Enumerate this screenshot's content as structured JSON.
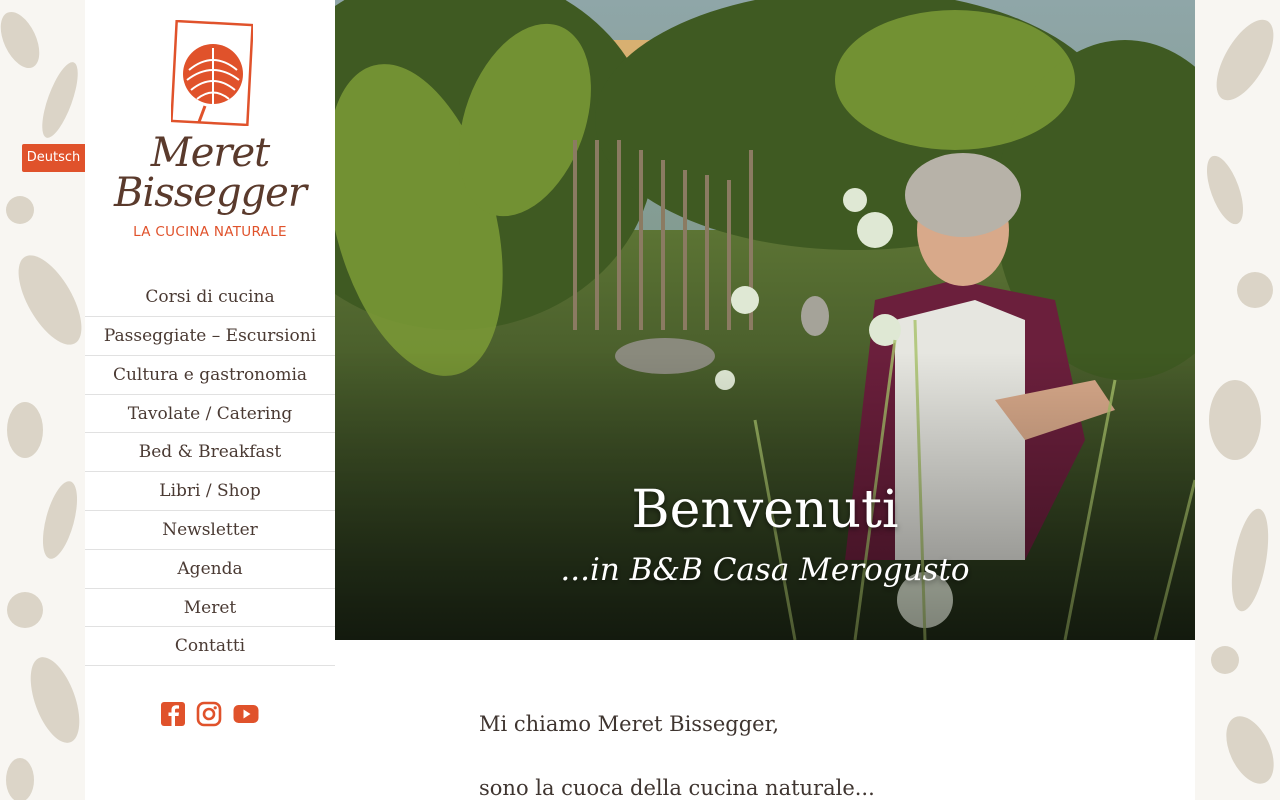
{
  "language": {
    "label": "Deutsch"
  },
  "logo": {
    "name_line1": "Meret",
    "name_line2": "Bissegger",
    "tagline": "LA CUCINA NATURALE"
  },
  "nav": {
    "items": [
      {
        "label": "Corsi di cucina"
      },
      {
        "label": "Passeggiate – Escursioni"
      },
      {
        "label": "Cultura e gastronomia"
      },
      {
        "label": "Tavolate / Catering"
      },
      {
        "label": "Bed & Breakfast"
      },
      {
        "label": "Libri / Shop"
      },
      {
        "label": "Newsletter"
      },
      {
        "label": "Agenda"
      },
      {
        "label": "Meret"
      },
      {
        "label": "Contatti"
      }
    ]
  },
  "social": {
    "icons": [
      "facebook-icon",
      "instagram-icon",
      "youtube-icon"
    ]
  },
  "hero": {
    "title": "Benvenuti",
    "subtitle": "...in B&B Casa Merogusto"
  },
  "content": {
    "line1": "Mi chiamo Meret Bissegger,",
    "line2": "sono la cuoca della cucina naturale..."
  },
  "colors": {
    "accent": "#e0522b",
    "text": "#4a3a33",
    "brand_brown": "#5a3a2c"
  }
}
